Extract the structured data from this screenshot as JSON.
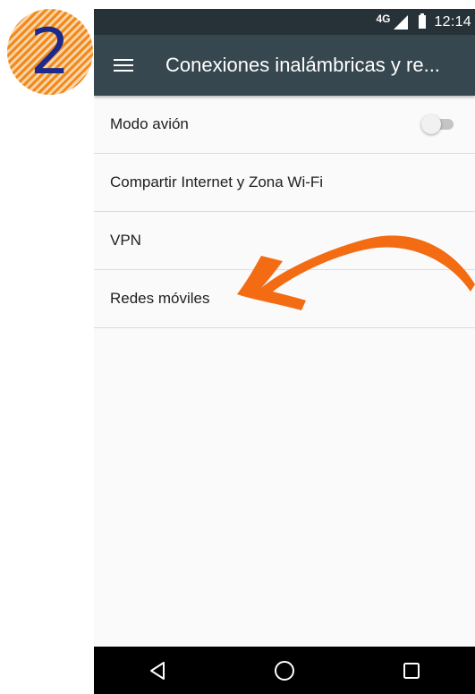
{
  "step_badge": {
    "number": "2",
    "color": "#f08a1e",
    "number_color": "#1c2a8a"
  },
  "status_bar": {
    "network": "4G",
    "time": "12:14"
  },
  "app_bar": {
    "title": "Conexiones inalámbricas y re...",
    "menu_icon": "hamburger-menu-icon"
  },
  "settings": {
    "items": [
      {
        "label": "Modo avión",
        "toggle": "off"
      },
      {
        "label": "Compartir Internet y Zona Wi-Fi"
      },
      {
        "label": "VPN"
      },
      {
        "label": "Redes móviles",
        "highlighted": true
      }
    ]
  },
  "nav_bar": {
    "icons": [
      "back-icon",
      "home-icon",
      "recents-icon"
    ]
  },
  "annotation": {
    "arrow_color": "#f36b12",
    "points_to": "Redes móviles"
  }
}
